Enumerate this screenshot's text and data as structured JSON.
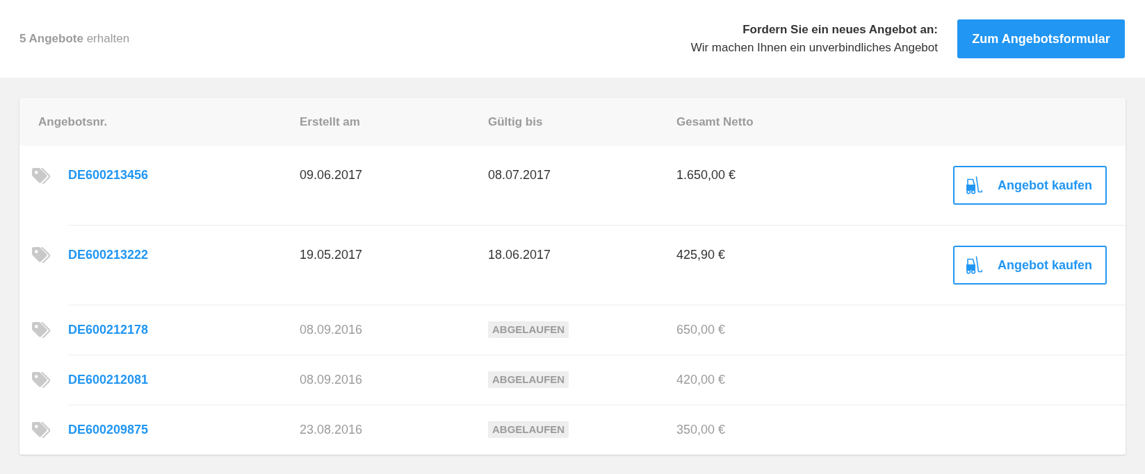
{
  "summary": "**5 Angebote** erhalten",
  "request": {
    "title": "Fordern Sie ein neues Angebot an:",
    "subtitle": "Wir machen Ihnen ein unverbindliches Angebot",
    "button": "Zum Angebotsformular"
  },
  "table": {
    "columns": [
      "Angebotsnr.",
      "Erstellt am",
      "Gültig bis",
      "Gesamt Netto"
    ],
    "rows": [
      {
        "offer_no": "DE600213456",
        "created": "09.06.2017",
        "valid_until": "08.07.2017",
        "total": "1.650,00 €",
        "expired": false,
        "action": "Angebot kaufen"
      },
      {
        "offer_no": "DE600213222",
        "created": "19.05.2017",
        "valid_until": "18.06.2017",
        "total": "425,90 €",
        "expired": false,
        "action": "Angebot kaufen"
      },
      {
        "offer_no": "DE600212178",
        "created": "08.09.2016",
        "status": "ABGELAUFEN",
        "total": "650,00 €",
        "expired": true
      },
      {
        "offer_no": "DE600212081",
        "created": "08.09.2016",
        "status": "ABGELAUFEN",
        "total": "420,00 €",
        "expired": true
      },
      {
        "offer_no": "DE600209875",
        "created": "23.08.2016",
        "status": "ABGELAUFEN",
        "total": "350,00 €",
        "expired": true
      }
    ]
  }
}
